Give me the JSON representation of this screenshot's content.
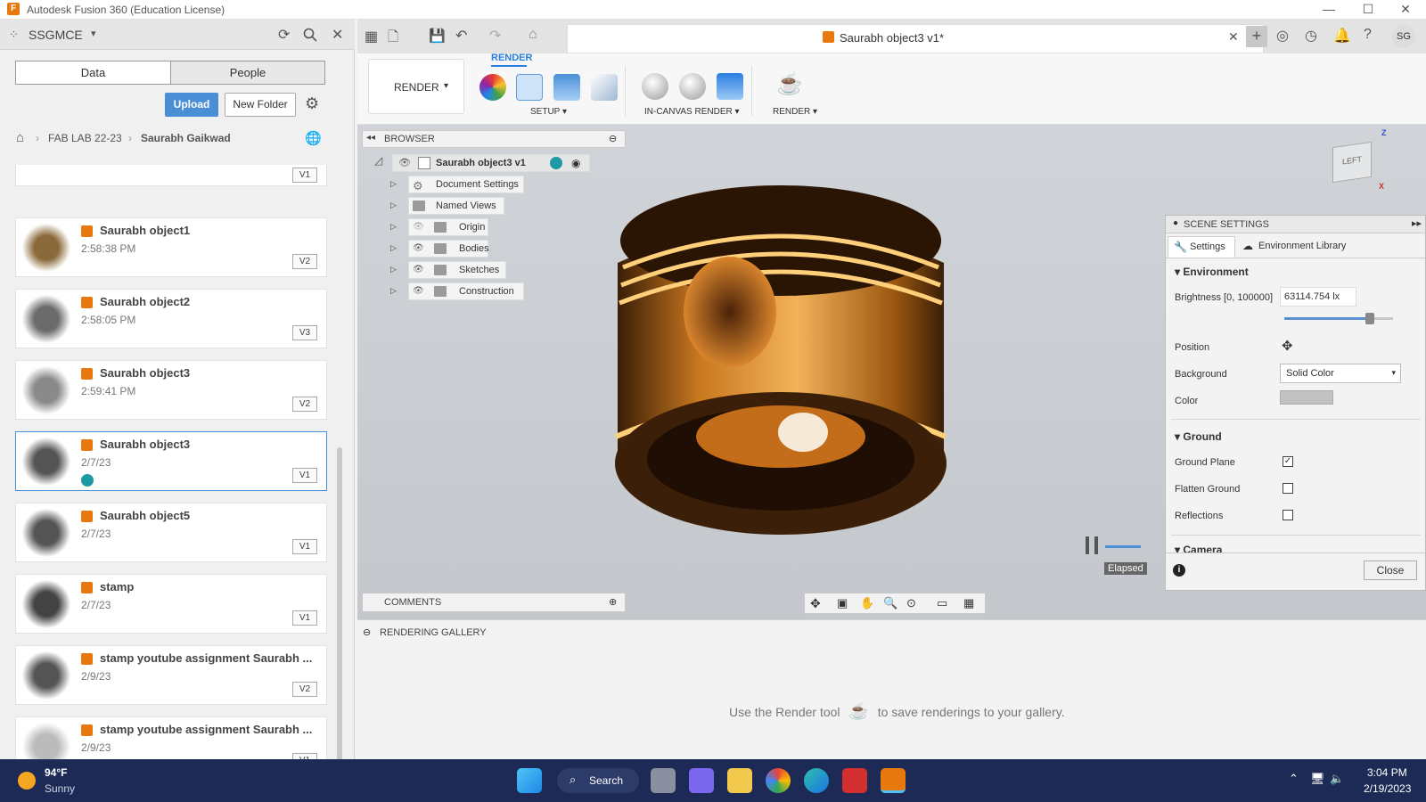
{
  "window": {
    "title": "Autodesk Fusion 360 (Education License)",
    "min_label": "—",
    "max_label": "☐",
    "close_label": "✕"
  },
  "data_panel": {
    "team": "SSGMCE",
    "tabs": [
      "Data",
      "People"
    ],
    "upload_label": "Upload",
    "new_folder_label": "New Folder",
    "breadcrumb": [
      "FAB LAB 22-23",
      "Saurabh Gaikwad"
    ],
    "top_version": "V1",
    "files": [
      {
        "name": "Saurabh object1",
        "date": "2:58:38 PM",
        "version": "V2",
        "selected": false,
        "shared": false
      },
      {
        "name": "Saurabh object2",
        "date": "2:58:05 PM",
        "version": "V3",
        "selected": false,
        "shared": false
      },
      {
        "name": "Saurabh object3",
        "date": "2:59:41 PM",
        "version": "V2",
        "selected": false,
        "shared": false
      },
      {
        "name": "Saurabh object3",
        "date": "2/7/23",
        "version": "V1",
        "selected": true,
        "shared": true
      },
      {
        "name": "Saurabh object5",
        "date": "2/7/23",
        "version": "V1",
        "selected": false,
        "shared": false
      },
      {
        "name": "stamp",
        "date": "2/7/23",
        "version": "V1",
        "selected": false,
        "shared": false
      },
      {
        "name": "stamp youtube assignment Saurabh ...",
        "date": "2/9/23",
        "version": "V2",
        "selected": false,
        "shared": false
      },
      {
        "name": "stamp youtube assignment Saurabh ...",
        "date": "2/9/23",
        "version": "V1",
        "selected": false,
        "shared": false
      }
    ]
  },
  "document": {
    "tab_title": "Saurabh object3 v1*",
    "user_initials": "SG"
  },
  "ribbon": {
    "workspace_label": "RENDER",
    "active_tab": "RENDER",
    "groups": [
      "SETUP ▾",
      "IN-CANVAS RENDER ▾",
      "RENDER ▾"
    ]
  },
  "browser": {
    "title": "BROWSER",
    "root": "Saurabh object3 v1",
    "items": [
      "Document Settings",
      "Named Views",
      "Origin",
      "Bodies",
      "Sketches",
      "Construction"
    ]
  },
  "comments_label": "COMMENTS",
  "viewcube_label": "LEFT",
  "scene_settings": {
    "title": "SCENE SETTINGS",
    "tabs": [
      "Settings",
      "Environment Library"
    ],
    "environment_label": "Environment",
    "brightness_label": "Brightness [0, 100000]",
    "brightness_value": "63114.754 lx",
    "brightness_fraction": 0.79,
    "position_label": "Position",
    "background_label": "Background",
    "background_value": "Solid Color",
    "color_label": "Color",
    "ground_label": "Ground",
    "ground_plane_label": "Ground Plane",
    "ground_plane_checked": true,
    "flatten_ground_label": "Flatten Ground",
    "flatten_ground_checked": false,
    "reflections_label": "Reflections",
    "reflections_checked": false,
    "camera_label": "Camera",
    "close_label": "Close",
    "elapsed_label": "Elapsed"
  },
  "gallery": {
    "title": "RENDERING GALLERY",
    "message_before": "Use the Render tool",
    "message_after": "to save renderings to your gallery."
  },
  "taskbar": {
    "weather_temp": "94°F",
    "weather_text": "Sunny",
    "search_label": "Search",
    "time": "3:04 PM",
    "date": "2/19/2023"
  }
}
